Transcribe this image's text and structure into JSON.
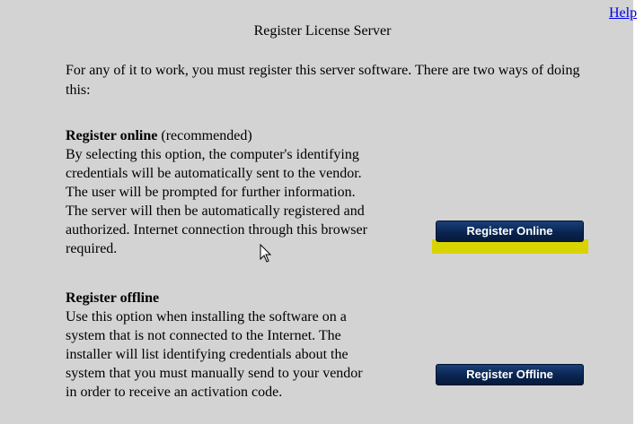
{
  "help": {
    "label": "Help"
  },
  "title": "Register License Server",
  "intro": "For any of it to work, you must register this server software. There are two ways of doing this:",
  "online": {
    "heading": "Register online",
    "heading_note": " (recommended)",
    "text": "By selecting this option, the computer's identifying\ncredentials will be automatically sent to the vendor.\nThe user will be prompted for further information.\nThe server will then be automatically registered and\nauthorized. Internet connection through this browser\nrequired.",
    "button_label": "Register Online"
  },
  "offline": {
    "heading": "Register offline",
    "text": "Use this option when installing the software on a\nsystem that is not connected to the Internet. The\ninstaller will list identifying credentials about the\nsystem that you must manually send to your vendor\nin order to receive an activation code.",
    "button_label": "Register Offline"
  },
  "colors": {
    "panel_bg": "#d3d3d3",
    "button_bg": "#0a2550",
    "highlight": "#d9d300",
    "link": "#0000ee"
  },
  "icons": {
    "cursor": "mouse-pointer-icon"
  }
}
